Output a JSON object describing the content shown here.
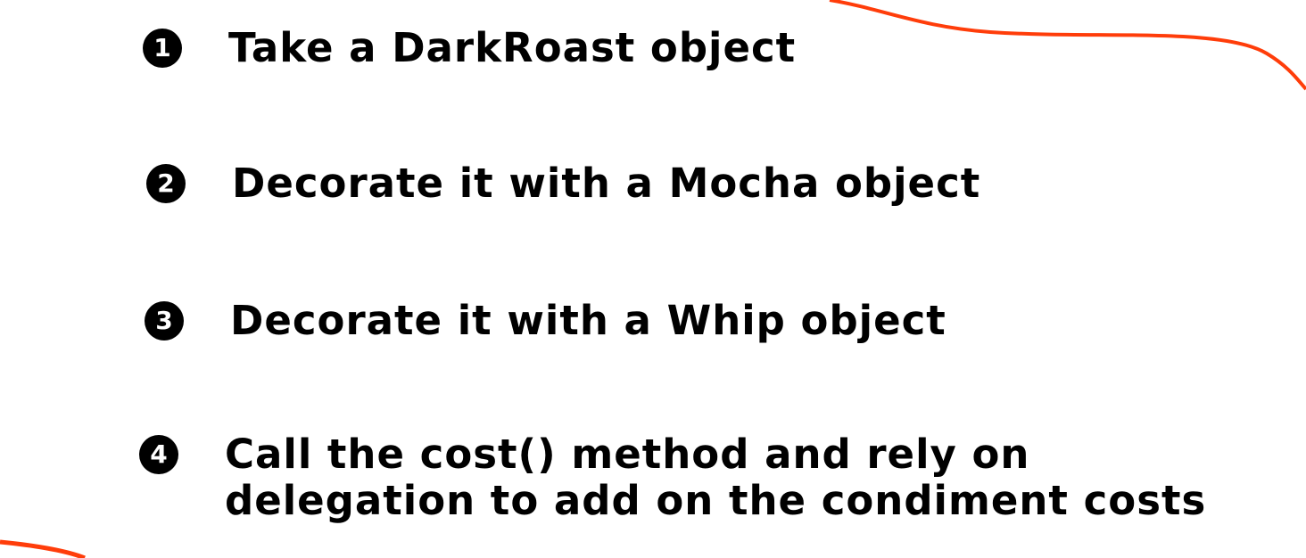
{
  "accent_color": "#ff3d0a",
  "steps": [
    {
      "number": "1",
      "text": "Take a DarkRoast object"
    },
    {
      "number": "2",
      "text": "Decorate it with a Mocha object"
    },
    {
      "number": "3",
      "text": "Decorate it with a Whip object"
    },
    {
      "number": "4",
      "line1": "Call the cost() method and rely on",
      "line2": "delegation to add on the condiment costs"
    }
  ]
}
